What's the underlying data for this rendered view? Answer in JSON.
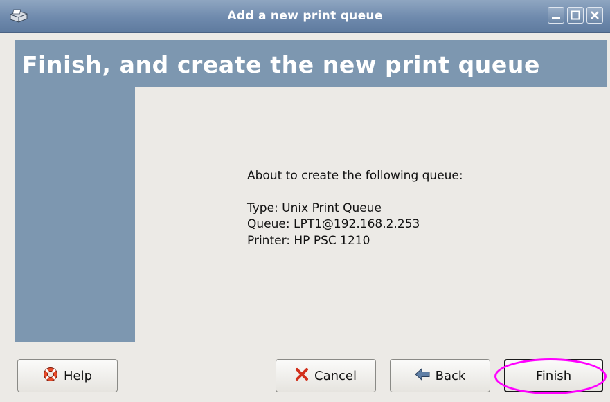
{
  "window": {
    "title": "Add a new print queue"
  },
  "header": {
    "title": "Finish, and create the new print queue"
  },
  "content": {
    "intro": "About to create the following queue:",
    "type_line": "Type: Unix Print Queue",
    "queue_line": "Queue: LPT1@192.168.2.253",
    "printer_line": "Printer: HP PSC 1210"
  },
  "buttons": {
    "help_mnemonic": "H",
    "help_rest": "elp",
    "cancel_mnemonic": "C",
    "cancel_rest": "ancel",
    "back_mnemonic": "B",
    "back_rest": "ack",
    "finish": "Finish"
  },
  "colors": {
    "titlebar": "#6f8aad",
    "header_band": "#7d97b0",
    "window_bg": "#eceae6",
    "highlight_ring": "#ff00ff"
  },
  "icons": {
    "app": "printer-icon",
    "help": "lifebuoy-icon",
    "cancel": "x-icon",
    "back": "arrow-left-icon"
  }
}
